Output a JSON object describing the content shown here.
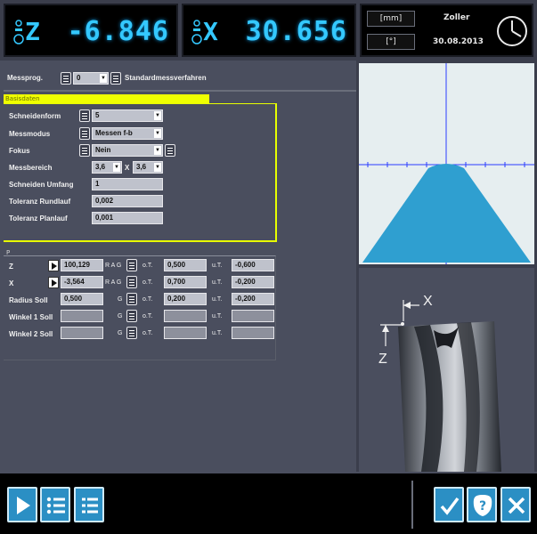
{
  "dro": {
    "z": {
      "axis": "Z",
      "value": "-6.846"
    },
    "x": {
      "axis": "X",
      "value": "30.656"
    }
  },
  "units": {
    "length": "[mm]",
    "angle": "[°]"
  },
  "header": {
    "vendor": "Zoller",
    "date": "30.08.2013"
  },
  "messprog": {
    "label": "Messprog.",
    "value": "0",
    "name": "Standardmessverfahren"
  },
  "basisdaten": {
    "title": "Basisdaten",
    "rows": {
      "schneidenform": {
        "label": "Schneidenform",
        "value": "5"
      },
      "messmodus": {
        "label": "Messmodus",
        "value": "Messen f-b"
      },
      "fokus": {
        "label": "Fokus",
        "value": "Nein"
      },
      "messbereich": {
        "label": "Messbereich",
        "value1": "3,6",
        "sep": "X",
        "value2": "3,6"
      },
      "schneiden_umfang": {
        "label": "Schneiden Umfang",
        "value": "1"
      },
      "toleranz_rundlauf": {
        "label": "Toleranz Rundlauf",
        "value": "0,002"
      },
      "toleranz_planlauf": {
        "label": "Toleranz Planlauf",
        "value": "0,001"
      }
    }
  },
  "params": {
    "section": "P",
    "ot_label": "o.T.",
    "ut_label": "u.T.",
    "rows": [
      {
        "label": "Z",
        "value": "100,129",
        "flags": "R A G",
        "ot": "0,500",
        "ut": "-0,600",
        "play": true
      },
      {
        "label": "X",
        "value": "-3,564",
        "flags": "R A G",
        "ot": "0,700",
        "ut": "-0,200",
        "play": true
      },
      {
        "label": "Radius Soll",
        "value": "0,500",
        "flags": "G",
        "ot": "0,200",
        "ut": "-0,200",
        "play": false
      },
      {
        "label": "Winkel 1 Soll",
        "value": "",
        "flags": "G",
        "ot": "",
        "ut": "",
        "play": false
      },
      {
        "label": "Winkel 2 Soll",
        "value": "",
        "flags": "G",
        "ot": "",
        "ut": "",
        "play": false
      }
    ]
  },
  "diagram": {
    "x_label": "X",
    "z_label": "Z"
  },
  "colors": {
    "lcd_text": "#34c8ff",
    "section_bar": "#f0ff00",
    "profile_fill": "#2f9fd0",
    "crosshair": "#2a3cff"
  },
  "toolbar": {
    "left": [
      "play-icon",
      "list-icon",
      "list-detail-icon"
    ],
    "right": [
      "check-icon",
      "help-icon",
      "close-icon"
    ]
  }
}
